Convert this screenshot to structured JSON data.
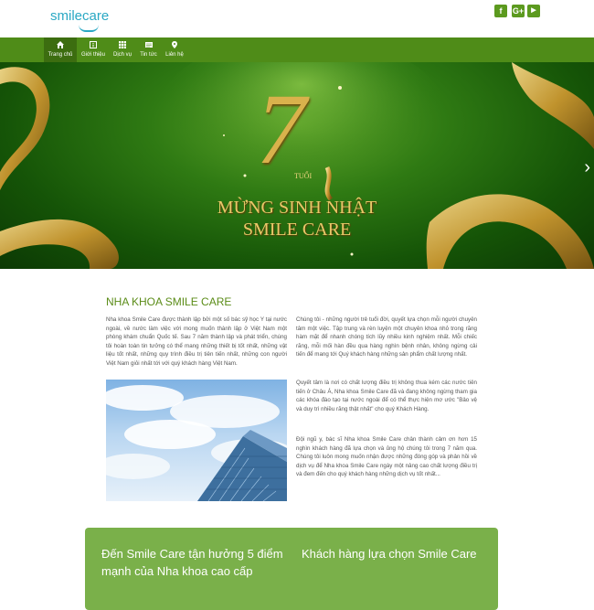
{
  "header": {
    "logo": "smilecare",
    "social": [
      {
        "icon": "facebook-icon",
        "glyph": "f"
      },
      {
        "icon": "google-plus-icon",
        "glyph": "G+"
      },
      {
        "icon": "youtube-icon",
        "glyph": "▶"
      }
    ]
  },
  "nav": {
    "items": [
      {
        "label": "Trang chủ",
        "icon": "home-icon",
        "active": true
      },
      {
        "label": "Giới thiệu",
        "icon": "info-icon",
        "active": false
      },
      {
        "label": "Dịch vụ",
        "icon": "grid-icon",
        "active": false
      },
      {
        "label": "Tin tức",
        "icon": "news-icon",
        "active": false
      },
      {
        "label": "Liên hệ",
        "icon": "location-pin-icon",
        "active": false
      }
    ]
  },
  "hero": {
    "number": "7",
    "age_unit": "TUỔI",
    "line1": "MỪNG SINH NHẬT",
    "line2": "SMILE CARE",
    "next_arrow": "›"
  },
  "about": {
    "title": "NHA KHOA SMILE CARE",
    "left_text": "Nha khoa Smile Care được thành lập bởi một số bác sỹ học Y tại nước ngoài, về nước làm việc với mong muốn thành lập ở Việt Nam một phòng khám chuẩn Quốc tế. Sau 7 năm thành lập và phát triển, chúng tôi hoàn toàn tin tưởng có thể mang những thiết bị tốt nhất, những vật liệu tốt nhất, những quy trình điều trị tiên tiến nhất, những con người Việt Nam giỏi nhất tới với quý khách hàng Việt Nam.",
    "right_p1": "Chúng tôi - những người trẻ tuổi đời, quyết lựa chọn mỗi người chuyên tâm một việc. Tập trung và rèn luyện một chuyên khoa nhỏ trong răng hàm mặt để nhanh chóng tích lũy nhiều kinh nghiệm nhất. Mỗi chiếc răng, mỗi mối hàn đều qua hàng nghìn bệnh nhân, không ngừng cải tiến để mang tới Quý khách hàng những sản phẩm chất lượng nhất.",
    "right_p2": "Quyết tâm là nơi có chất lượng điều trị không thua kém các nước tiên tiến ở Châu Á, Nha khoa Smile Care đã và đang không ngừng tham gia các khóa đào tạo tại nước ngoài để có thể thực hiện mơ ước \"Bảo vệ và duy trì nhiều răng thật nhất\" cho quý Khách Hàng.",
    "right_p3": "Đội ngũ y, bác sĩ Nha khoa Smile Care chân thành cảm ơn hơn 15 nghìn khách hàng đã lựa chọn và ủng hộ chúng tôi trong 7 năm qua. Chúng tôi luôn mong muốn nhận được những đóng góp và phản hồi về dịch vụ để Nha khoa Smile Care ngày một nâng cao chất lượng điều trị và đem đến cho quý khách hàng những dịch vụ tốt nhất..."
  },
  "features": {
    "left_heading": "Đến Smile Care tận hưởng 5 điểm mạnh của Nha khoa cao cấp",
    "right_heading": "Khách hàng lựa chọn Smile Care"
  },
  "colors": {
    "brand_green": "#4f8c18",
    "logo_blue": "#2aa8c4",
    "feature_box": "#7ab04a"
  }
}
